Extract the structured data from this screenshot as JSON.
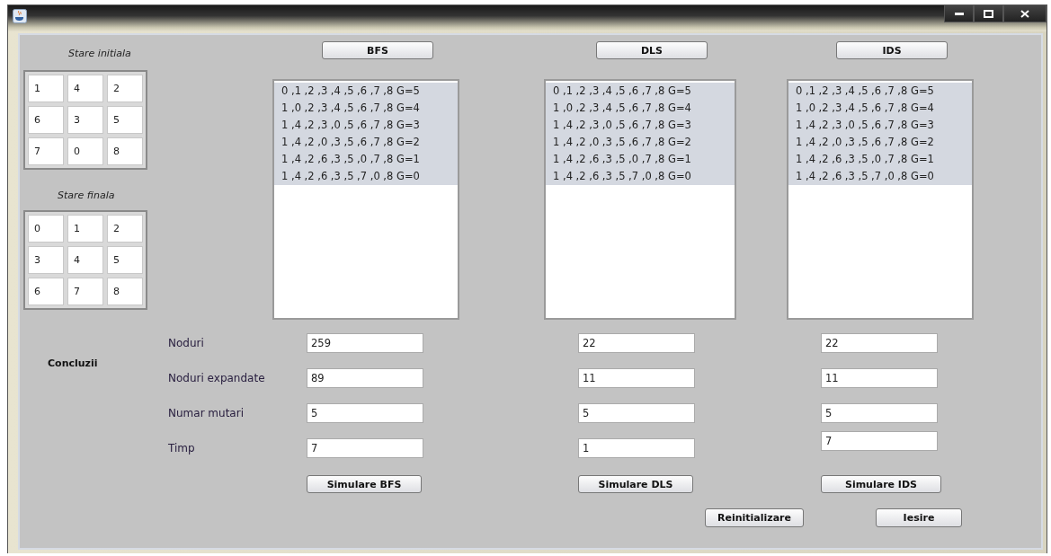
{
  "initial_state": {
    "label": "Stare initiala",
    "tiles": [
      "1",
      "4",
      "2",
      "6",
      "3",
      "5",
      "7",
      "0",
      "8"
    ]
  },
  "final_state": {
    "label": "Stare finala",
    "tiles": [
      "0",
      "1",
      "2",
      "3",
      "4",
      "5",
      "6",
      "7",
      "8"
    ]
  },
  "algorithms": [
    {
      "button": "BFS",
      "list": [
        {
          "text": "0 ,1 ,2 ,3 ,4 ,5 ,6 ,7 ,8  G=5",
          "selected": true
        },
        {
          "text": "1 ,0 ,2 ,3 ,4 ,5 ,6 ,7 ,8  G=4",
          "selected": true
        },
        {
          "text": "1 ,4 ,2 ,3 ,0 ,5 ,6 ,7 ,8  G=3",
          "selected": true
        },
        {
          "text": "1 ,4 ,2 ,0 ,3 ,5 ,6 ,7 ,8  G=2",
          "selected": true
        },
        {
          "text": "1 ,4 ,2 ,6 ,3 ,5 ,0 ,7 ,8  G=1",
          "selected": true
        },
        {
          "text": "1 ,4 ,2 ,6 ,3 ,5 ,7 ,0 ,8  G=0",
          "selected": true
        }
      ],
      "values": [
        "259",
        "89",
        "5",
        "7"
      ],
      "simulate": "Simulare BFS"
    },
    {
      "button": "DLS",
      "list": [
        {
          "text": "0 ,1 ,2 ,3 ,4 ,5 ,6 ,7 ,8  G=5",
          "selected": true
        },
        {
          "text": "1 ,0 ,2 ,3 ,4 ,5 ,6 ,7 ,8  G=4",
          "selected": true
        },
        {
          "text": "1 ,4 ,2 ,3 ,0 ,5 ,6 ,7 ,8  G=3",
          "selected": true
        },
        {
          "text": "1 ,4 ,2 ,0 ,3 ,5 ,6 ,7 ,8  G=2",
          "selected": true
        },
        {
          "text": "1 ,4 ,2 ,6 ,3 ,5 ,0 ,7 ,8  G=1",
          "selected": true
        },
        {
          "text": "1 ,4 ,2 ,6 ,3 ,5 ,7 ,0 ,8  G=0",
          "selected": true
        }
      ],
      "values": [
        "22",
        "11",
        "5",
        "1"
      ],
      "simulate": "Simulare DLS"
    },
    {
      "button": "IDS",
      "list": [
        {
          "text": "0 ,1 ,2 ,3 ,4 ,5 ,6 ,7 ,8  G=5",
          "selected": true
        },
        {
          "text": "1 ,0 ,2 ,3 ,4 ,5 ,6 ,7 ,8  G=4",
          "selected": true
        },
        {
          "text": "1 ,4 ,2 ,3 ,0 ,5 ,6 ,7 ,8  G=3",
          "selected": true
        },
        {
          "text": "1 ,4 ,2 ,0 ,3 ,5 ,6 ,7 ,8  G=2",
          "selected": true
        },
        {
          "text": "1 ,4 ,2 ,6 ,3 ,5 ,0 ,7 ,8  G=1",
          "selected": true
        },
        {
          "text": "1 ,4 ,2 ,6 ,3 ,5 ,7 ,0 ,8  G=0",
          "selected": true
        }
      ],
      "values": [
        "22",
        "11",
        "5",
        "7"
      ],
      "simulate": "Simulare IDS"
    }
  ],
  "conclusions": {
    "label": "Concluzii",
    "rows": [
      "Noduri",
      "Noduri expandate",
      "Numar mutari",
      "Timp"
    ]
  },
  "buttons": [
    "Reinitializare",
    "Iesire"
  ]
}
